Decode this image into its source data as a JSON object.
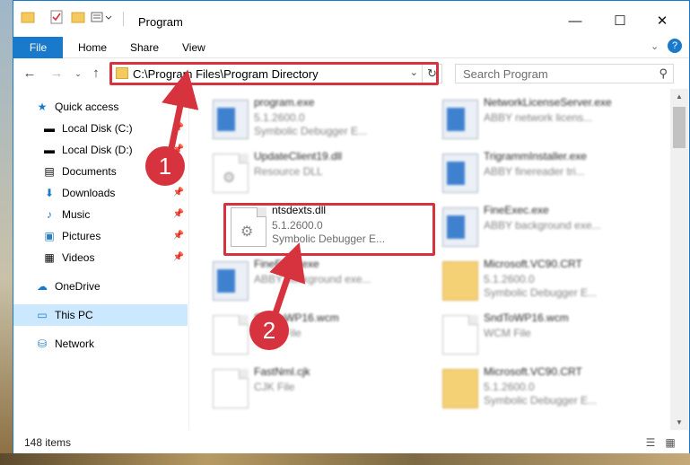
{
  "window": {
    "title": "Program",
    "controls": {
      "minimize": "—",
      "maximize": "☐",
      "close": "✕"
    }
  },
  "ribbon": {
    "tabs": [
      "File",
      "Home",
      "Share",
      "View"
    ],
    "help": "?"
  },
  "address": {
    "path": "C:\\Program Files\\Program Directory",
    "search_placeholder": "Search Program"
  },
  "nav": {
    "items": [
      {
        "label": "Quick access",
        "icon": "star-icon",
        "pinned": false
      },
      {
        "label": "Local Disk (C:)",
        "icon": "drive-icon",
        "pinned": true
      },
      {
        "label": "Local Disk (D:)",
        "icon": "drive-icon",
        "pinned": true
      },
      {
        "label": "Documents",
        "icon": "documents-icon",
        "pinned": true
      },
      {
        "label": "Downloads",
        "icon": "download-icon",
        "pinned": true
      },
      {
        "label": "Music",
        "icon": "music-icon",
        "pinned": true
      },
      {
        "label": "Pictures",
        "icon": "pictures-icon",
        "pinned": true
      },
      {
        "label": "Videos",
        "icon": "videos-icon",
        "pinned": true
      },
      {
        "label": "OneDrive",
        "icon": "cloud-icon",
        "pinned": false
      },
      {
        "label": "This PC",
        "icon": "computer-icon",
        "pinned": false
      },
      {
        "label": "Network",
        "icon": "network-icon",
        "pinned": false
      }
    ]
  },
  "files": [
    {
      "name": "program.exe",
      "line2": "5.1.2600.0",
      "line3": "Symbolic Debugger E...",
      "icon": "app-icon"
    },
    {
      "name": "NetworkLicenseServer.exe",
      "line2": "ABBY network licens...",
      "line3": "",
      "icon": "app-icon"
    },
    {
      "name": "UpdateClient19.dll",
      "line2": "Resource DLL",
      "line3": "",
      "icon": "dll-icon"
    },
    {
      "name": "TrigrammInstaller.exe",
      "line2": "ABBY finereader tri...",
      "line3": "",
      "icon": "app-icon"
    },
    {
      "name": "ntsdexts.dll",
      "line2": "5.1.2600.0",
      "line3": "Symbolic Debugger E...",
      "icon": "dll-icon"
    },
    {
      "name": "FineExec.exe",
      "line2": "ABBY background exe...",
      "line3": "",
      "icon": "app-icon"
    },
    {
      "name": "FineExec.exe",
      "line2": "ABBY background exe...",
      "line3": "",
      "icon": "app-icon"
    },
    {
      "name": "Microsoft.VC90.CRT",
      "line2": "5.1.2600.0",
      "line3": "Symbolic Debugger E...",
      "icon": "folder-icon"
    },
    {
      "name": "SndToWP16.wcm",
      "line2": "WCM File",
      "line3": "",
      "icon": "file-icon"
    },
    {
      "name": "SndToWP16.wcm",
      "line2": "WCM File",
      "line3": "",
      "icon": "file-icon"
    },
    {
      "name": "FastNml.cjk",
      "line2": "CJK File",
      "line3": "",
      "icon": "file-icon"
    },
    {
      "name": "Microsoft.VC90.CRT",
      "line2": "5.1.2600.0",
      "line3": "Symbolic Debugger E...",
      "icon": "folder-icon"
    }
  ],
  "status": {
    "count": "148 items"
  },
  "annotations": {
    "step1": "1",
    "step2": "2",
    "color": "#d6333f"
  }
}
